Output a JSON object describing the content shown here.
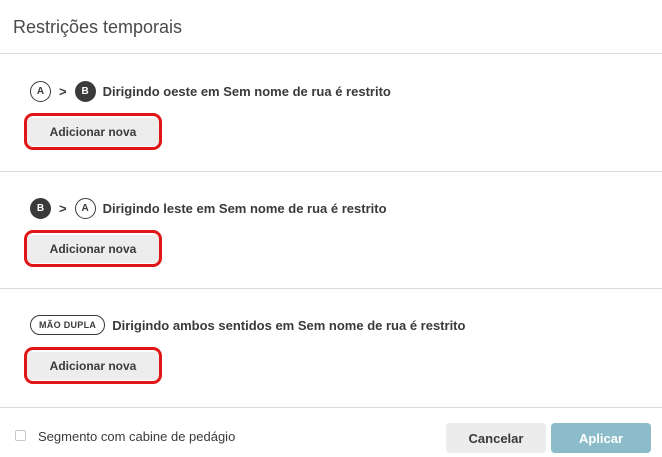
{
  "dialog": {
    "title": "Restrições temporais"
  },
  "sections": [
    {
      "from": "A",
      "separator": ">",
      "to": "B",
      "description": "Dirigindo oeste em Sem nome de rua é restrito",
      "add_label": "Adicionar nova"
    },
    {
      "from": "B",
      "separator": ">",
      "to": "A",
      "description": "Dirigindo leste em Sem nome de rua é restrito",
      "add_label": "Adicionar nova"
    },
    {
      "badge": "MÃO DUPLA",
      "description": "Dirigindo ambos sentidos em Sem nome de rua é restrito",
      "add_label": "Adicionar nova"
    }
  ],
  "footer": {
    "toll_checkbox_label": "Segmento com cabine de pedágio",
    "toll_checked": false,
    "cancel_label": "Cancelar",
    "apply_label": "Aplicar"
  },
  "colors": {
    "highlight": "#e01515",
    "apply_button": "#8cbcc9",
    "text": "#3a3a3a"
  }
}
